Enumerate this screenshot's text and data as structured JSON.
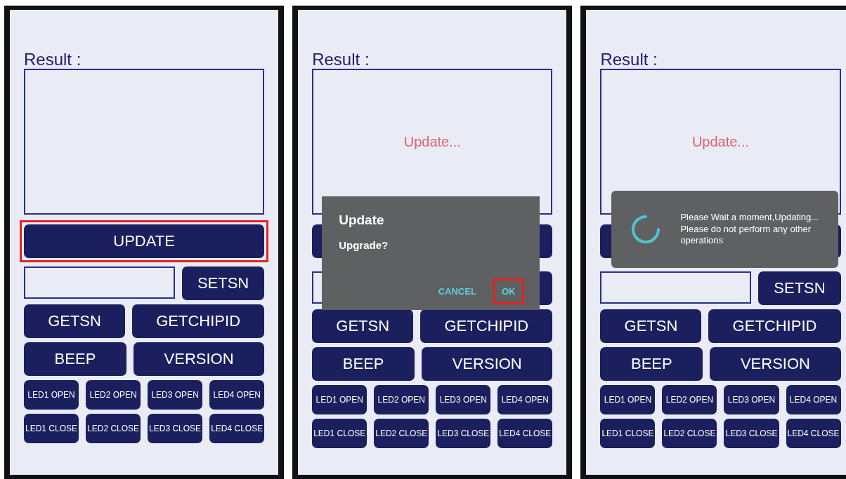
{
  "panels": [
    {
      "result_label": "Result :",
      "update_button": {
        "label": "UPDATE",
        "highlighted": true
      },
      "setsn_button": {
        "label": "SETSN"
      },
      "rows": [
        [
          "GETSN",
          "GETCHIPID"
        ],
        [
          "BEEP",
          "VERSION"
        ],
        [
          "LED1 OPEN",
          "LED2 OPEN",
          "LED3 OPEN",
          "LED4 OPEN"
        ],
        [
          "LED1 CLOSE",
          "LED2 CLOSE",
          "LED3 CLOSE",
          "LED4 CLOSE"
        ]
      ]
    },
    {
      "result_label": "Result :",
      "result_text": "Update...",
      "update_button": {
        "highlighted": false
      },
      "rows": [
        [
          "GETSN",
          "GETCHIPID"
        ],
        [
          "BEEP",
          "VERSION"
        ],
        [
          "LED1 OPEN",
          "LED2 OPEN",
          "LED3 OPEN",
          "LED4 OPEN"
        ],
        [
          "LED1 CLOSE",
          "LED2 CLOSE",
          "LED3 CLOSE",
          "LED4 CLOSE"
        ]
      ],
      "dialog": {
        "kind": "confirm",
        "title": "Update",
        "message": "Upgrade?",
        "buttons": [
          {
            "label": "CANCEL",
            "highlighted": false
          },
          {
            "label": "OK",
            "highlighted": true
          }
        ]
      }
    },
    {
      "result_label": "Result :",
      "result_text": "Update...",
      "update_button": {
        "highlighted": false
      },
      "setsn_button": {
        "label": "SETSN"
      },
      "rows": [
        [
          "GETSN",
          "GETCHIPID"
        ],
        [
          "BEEP",
          "VERSION"
        ],
        [
          "LED1 OPEN",
          "LED2 OPEN",
          "LED3 OPEN",
          "LED4 OPEN"
        ],
        [
          "LED1 CLOSE",
          "LED2 CLOSE",
          "LED3 CLOSE",
          "LED4 CLOSE"
        ]
      ],
      "dialog": {
        "kind": "progress",
        "message": "Please Wait a moment,Updating...\n Please do not perform any other operations"
      }
    }
  ]
}
